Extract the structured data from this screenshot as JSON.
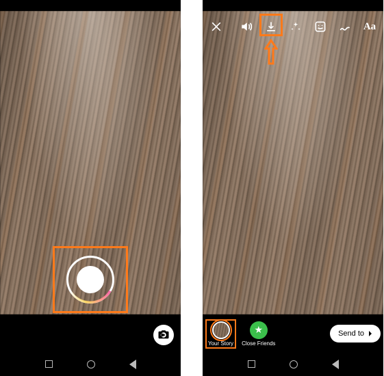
{
  "colors": {
    "highlight": "#ff7a1a",
    "close_friends": "#3bbf4b"
  },
  "left_phone": {
    "shutter_name": "capture-button",
    "flip_name": "switch-camera"
  },
  "right_phone": {
    "topbar": {
      "close_name": "close",
      "sound_name": "sound-toggle",
      "download_name": "download",
      "effects_name": "effects",
      "sticker_name": "sticker",
      "draw_name": "draw",
      "text_name": "text",
      "text_label": "Aa"
    },
    "highlight_target": "sound-toggle",
    "bottom": {
      "your_story": {
        "label": "Your Story",
        "selected": true
      },
      "close_friends": {
        "label": "Close Friends"
      },
      "send_to": {
        "label": "Send to"
      }
    }
  }
}
